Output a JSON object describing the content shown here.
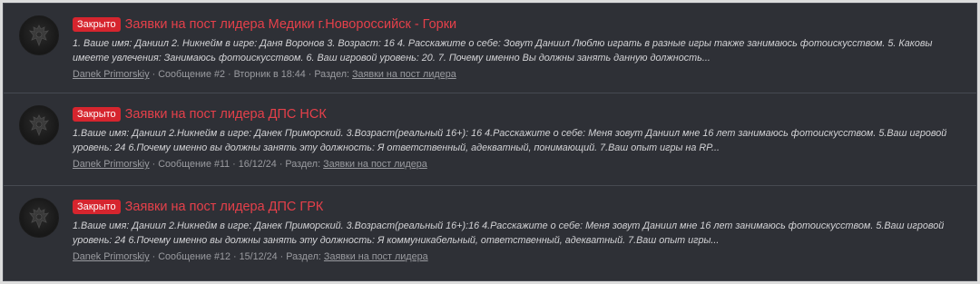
{
  "results": [
    {
      "badge": "Закрыто",
      "title": "Заявки на пост лидера Медики г.Новороссийск - Горки",
      "snippet": "1. Ваше имя: Даниил 2. Никнейм в игре: Даня Воронов 3. Возраст: 16 4. Расскажите о себе: Зовут Даниил Люблю играть в разные игры также занимаюсь фотоискусством. 5. Каковы имеете увлечения: Занимаюсь фотоискусством. 6. Ваш игровой уровень: 20. 7. Почему именно Вы должны занять данную должность...",
      "author": "Danek Primorskiy",
      "sep": "·",
      "message": "Сообщение #2",
      "date": "Вторник в 18:44",
      "section_label": "Раздел:",
      "section": "Заявки на пост лидера"
    },
    {
      "badge": "Закрыто",
      "title": "Заявки на пост лидера ДПС НСК",
      "snippet": "1.Ваше имя: Даниил 2.Никнейм в игре: Данек Приморский. 3.Возраст(реальный 16+): 16 4.Расскажите о себе: Меня зовут Даниил мне 16 лет занимаюсь фотоискусством. 5.Ваш игровой уровень: 24 6.Почему именно вы должны занять эту должность: Я ответственный, адекватный, понимающий. 7.Ваш опыт игры на RP...",
      "author": "Danek Primorskiy",
      "sep": "·",
      "message": "Сообщение #11",
      "date": "16/12/24",
      "section_label": "Раздел:",
      "section": "Заявки на пост лидера"
    },
    {
      "badge": "Закрыто",
      "title": "Заявки на пост лидера ДПС ГРК",
      "snippet": "1.Ваше имя: Даниил 2.Никнейм в игре: Данек Приморский. 3.Возраст(реальный 16+):16 4.Расскажите о себе: Меня зовут Даниил мне 16 лет занимаюсь фотоискусством. 5.Ваш игровой уровень: 24 6.Почему именно вы должны занять эту должность: Я коммуникабельный, ответственный, адекватный. 7.Ваш опыт игры...",
      "author": "Danek Primorskiy",
      "sep": "·",
      "message": "Сообщение #12",
      "date": "15/12/24",
      "section_label": "Раздел:",
      "section": "Заявки на пост лидера"
    }
  ],
  "colors": {
    "badge_bg": "#d6252e",
    "title": "#e5404a",
    "panel_bg": "#2e3036"
  },
  "icons": {
    "avatar": "double-headed-eagle-emblem"
  }
}
